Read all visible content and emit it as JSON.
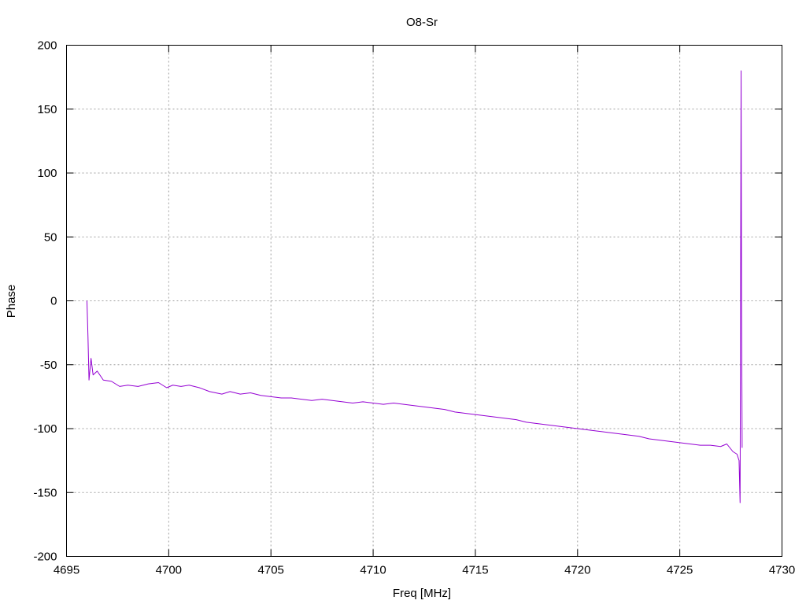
{
  "chart_data": {
    "type": "line",
    "title": "O8-Sr",
    "xlabel": "Freq [MHz]",
    "ylabel": "Phase",
    "xlim": [
      4695,
      4730
    ],
    "ylim": [
      -200,
      200
    ],
    "xticks": [
      4695,
      4700,
      4705,
      4710,
      4715,
      4720,
      4725,
      4730
    ],
    "yticks": [
      -200,
      -150,
      -100,
      -50,
      0,
      50,
      100,
      150,
      200
    ],
    "grid": true,
    "legend": "none",
    "colors": {
      "series": "#9400d3",
      "grid": "#a0a0a0"
    },
    "series": [
      {
        "x": [
          4696.0,
          4696.05,
          4696.1,
          4696.2,
          4696.3,
          4696.5,
          4696.8,
          4697.2,
          4697.6,
          4698.0,
          4698.5,
          4699.0,
          4699.5,
          4699.9,
          4700.2,
          4700.6,
          4701.0,
          4701.5,
          4702.0,
          4702.6,
          4703.0,
          4703.5,
          4704.0,
          4704.5,
          4705.0,
          4705.5,
          4706.0,
          4706.5,
          4707.0,
          4707.5,
          4708.0,
          4708.5,
          4709.0,
          4709.5,
          4710.0,
          4710.5,
          4711.0,
          4711.5,
          4712.0,
          4712.5,
          4713.0,
          4713.5,
          4714.0,
          4714.5,
          4715.0,
          4715.5,
          4716.0,
          4716.5,
          4717.0,
          4717.5,
          4718.0,
          4718.5,
          4719.0,
          4719.5,
          4720.0,
          4720.5,
          4721.0,
          4721.5,
          4722.0,
          4722.5,
          4723.0,
          4723.5,
          4724.0,
          4724.5,
          4725.0,
          4725.5,
          4726.0,
          4726.5,
          4727.0,
          4727.3,
          4727.6,
          4727.8,
          4727.9,
          4727.95,
          4728.0,
          4728.02,
          4728.05
        ],
        "y": [
          0,
          -28,
          -62,
          -45,
          -58,
          -55,
          -62,
          -63,
          -67,
          -66,
          -67,
          -65,
          -64,
          -68,
          -66,
          -67,
          -66,
          -68,
          -71,
          -73,
          -71,
          -73,
          -72,
          -74,
          -75,
          -76,
          -76,
          -77,
          -78,
          -77,
          -78,
          -79,
          -80,
          -79,
          -80,
          -81,
          -80,
          -81,
          -82,
          -83,
          -84,
          -85,
          -87,
          -88,
          -89,
          -90,
          -91,
          -92,
          -93,
          -95,
          -96,
          -97,
          -98,
          -99,
          -100,
          -101,
          -102,
          -103,
          -104,
          -105,
          -106,
          -108,
          -109,
          -110,
          -111,
          -112,
          -113,
          -113,
          -114,
          -112,
          -118,
          -120,
          -125,
          -158,
          180,
          10,
          -115
        ]
      }
    ]
  }
}
